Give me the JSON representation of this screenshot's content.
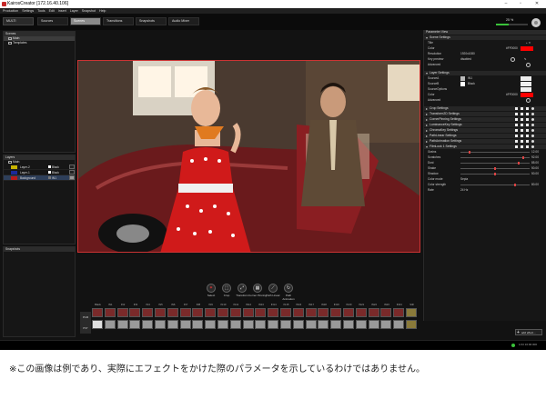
{
  "window": {
    "title": "KairosCreator [172.16.40.106]",
    "min": "–",
    "max": "▫",
    "close": "✕"
  },
  "menu": [
    "Production",
    "Settings",
    "Tools",
    "Edit",
    "Insert",
    "Layer",
    "Snapshot",
    "Help"
  ],
  "toolbar": {
    "multi": "MULTI",
    "tabs": [
      "Sources",
      "Scenes",
      "Transitions",
      "Snapshots",
      "Audio Mixer"
    ],
    "active_tab_index": 1,
    "zoom": "25 %",
    "zoom_fraction": 0.4
  },
  "scenes_panel": {
    "header": "Scenes",
    "items": [
      "Main",
      "Templates"
    ]
  },
  "layers_panel": {
    "header": "Layers",
    "root": "Main",
    "rows": [
      {
        "name": "Layer-2",
        "key": "Black",
        "color": "#c8b400"
      },
      {
        "name": "Layer-1",
        "key": "Black",
        "color": "#1a2a9a"
      },
      {
        "name": "Background",
        "key": "IN1",
        "color": "#b81a1a"
      }
    ]
  },
  "snapshots_panel": {
    "header": "Snapshots"
  },
  "params": {
    "header": "Parameter View",
    "scene_settings": {
      "label": "Scene Settings",
      "title": "Title",
      "color_label": "Color",
      "color_value": "#ff0000",
      "color_hex": "#FF0000",
      "resolution_label": "Resolution",
      "resolution_value": "1920x1080",
      "keyable_label": "Key preview",
      "keyable_value": "disabled",
      "advanced_label": "Advanced"
    },
    "layer_settings": {
      "label": "Layer Settings",
      "source_a_label": "SourceA",
      "source_a_value": "IN1",
      "source_b_label": "SourceB",
      "source_b_value": "Black",
      "source_options_label": "SourceOptions",
      "color_label": "Color",
      "color_hex": "#FF0000",
      "advanced_label": "Advanced"
    },
    "sections": [
      "Crop Settings",
      "Transform2D Settings",
      "CornerPinning Settings",
      "LuminanceKey Settings",
      "ChromaKey Settings",
      "PathLinear Settings",
      "PathAnimation Settings"
    ],
    "filmlook": {
      "label": "FilmLook 1 Settings",
      "sliders": [
        {
          "label": "Grains",
          "value": "12.00",
          "fraction": 0.12
        },
        {
          "label": "Scratches",
          "value": "92.00",
          "fraction": 0.92
        },
        {
          "label": "Dust",
          "value": "85.00",
          "fraction": 0.85
        },
        {
          "label": "Shake",
          "value": "50.00",
          "fraction": 0.5
        },
        {
          "label": "Shadow",
          "value": "50.00",
          "fraction": 0.5
        }
      ],
      "color_mode_label": "Color mode",
      "color_mode_value": "Sepia",
      "color_strength_label": "Color strength",
      "color_strength_value": "80.00",
      "color_strength_fraction": 0.8,
      "rate_label": "Rate",
      "rate_value": "24 Hz"
    }
  },
  "effects": [
    {
      "label": "Select",
      "glyph": "✶"
    },
    {
      "label": "Crop",
      "glyph": "⬚"
    },
    {
      "label": "Transform",
      "glyph": "⤢"
    },
    {
      "label": "Corner Pinning",
      "glyph": "▦"
    },
    {
      "label": "Path Linear",
      "glyph": "⟋"
    },
    {
      "label": "Path Animation",
      "glyph": "↻"
    }
  ],
  "pgm_rows": [
    "PGM",
    "PST"
  ],
  "sources_row": [
    "Black",
    "IN1",
    "IN2",
    "IN3",
    "IN4",
    "IN5",
    "IN6",
    "IN7",
    "IN8",
    "IN9",
    "IN10",
    "IN11",
    "IN12",
    "IN13",
    "IN14",
    "IN15",
    "IN16",
    "IN17",
    "IN18",
    "IN19",
    "IN20",
    "IN21",
    "IN22",
    "IN23",
    "IN24",
    "Still"
  ],
  "add_effect": "add effect...",
  "status_time": "1/13 16:00:300",
  "note": "※この画像は例であり、実際にエフェクトをかけた際のパラメータを示しているわけではありません。"
}
